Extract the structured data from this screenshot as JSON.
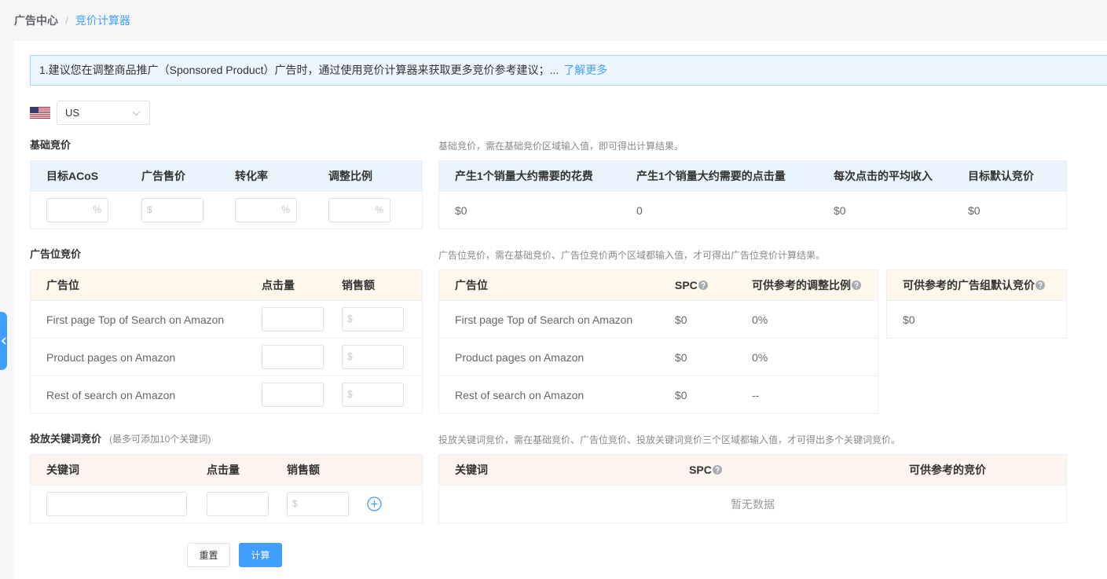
{
  "colors": {
    "accent": "#409eff",
    "notice_bg": "#edf6fe",
    "notice_border": "#a6d2f6",
    "base_header_bg": "#eaf4fe",
    "placement_header_bg": "#fdf8eb",
    "keyword_header_bg": "#fdf3ef"
  },
  "icons": {
    "marketplace_flag": "us-flag-icon",
    "select_arrow": "chevron-down-icon",
    "help": "question-circle-icon",
    "add_keyword": "plus-circle-icon",
    "sidebar_toggle": "chevron-left-icon"
  },
  "breadcrumb": {
    "root": "广告中心",
    "separator": "/",
    "current": "竞价计算器"
  },
  "notice": {
    "text": "1.建议您在调整商品推广（Sponsored Product）广告时，通过使用竞价计算器来获取更多竞价参考建议；...",
    "link": "了解更多"
  },
  "market": {
    "selected": "US"
  },
  "base_bid": {
    "title": "基础竞价",
    "hint": "基础竞价，需在基础竞价区域输入值，即可得出计算结果。",
    "inputs": [
      {
        "label": "目标ACoS",
        "affix": "%"
      },
      {
        "label": "广告售价",
        "affix": "$"
      },
      {
        "label": "转化率",
        "affix": "%"
      },
      {
        "label": "调整比例",
        "affix": "%"
      }
    ],
    "results": [
      {
        "label": "产生1个销量大约需要的花费",
        "value": "$0"
      },
      {
        "label": "产生1个销量大约需要的点击量",
        "value": "0"
      },
      {
        "label": "每次点击的平均收入",
        "value": "$0"
      },
      {
        "label": "目标默认竞价",
        "value": "$0"
      }
    ]
  },
  "placement_bid": {
    "title": "广告位竞价",
    "hint": "广告位竞价，需在基础竞价、广告位竞价两个区域都输入值，才可得出广告位竞价计算结果。",
    "input_headers": {
      "placement": "广告位",
      "clicks": "点击量",
      "sales": "销售额"
    },
    "sales_prefix": "$",
    "rows": [
      "First page Top of Search on Amazon",
      "Product pages on Amazon",
      "Rest of search on Amazon"
    ],
    "result_headers": {
      "placement": "广告位",
      "spc": "SPC",
      "ratio": "可供参考的调整比例"
    },
    "results": [
      {
        "placement": "First page Top of Search on Amazon",
        "spc": "$0",
        "ratio": "0%"
      },
      {
        "placement": "Product pages on Amazon",
        "spc": "$0",
        "ratio": "0%"
      },
      {
        "placement": "Rest of search on Amazon",
        "spc": "$0",
        "ratio": "--"
      }
    ],
    "default_bid": {
      "label": "可供参考的广告组默认竞价",
      "value": "$0"
    }
  },
  "keyword_bid": {
    "title": "投放关键词竞价",
    "note": "(最多可添加10个关键词)",
    "hint": "投放关键词竞价，需在基础竞价、广告位竞价、投放关键词竞价三个区域都输入值，才可得出多个关键词竞价。",
    "input_headers": {
      "keyword": "关键词",
      "clicks": "点击量",
      "sales": "销售额"
    },
    "sales_prefix": "$",
    "result_headers": {
      "keyword": "关键词",
      "spc": "SPC",
      "bid": "可供参考的竞价"
    },
    "empty_text": "暂无数据"
  },
  "actions": {
    "reset": "重置",
    "calculate": "计算"
  }
}
